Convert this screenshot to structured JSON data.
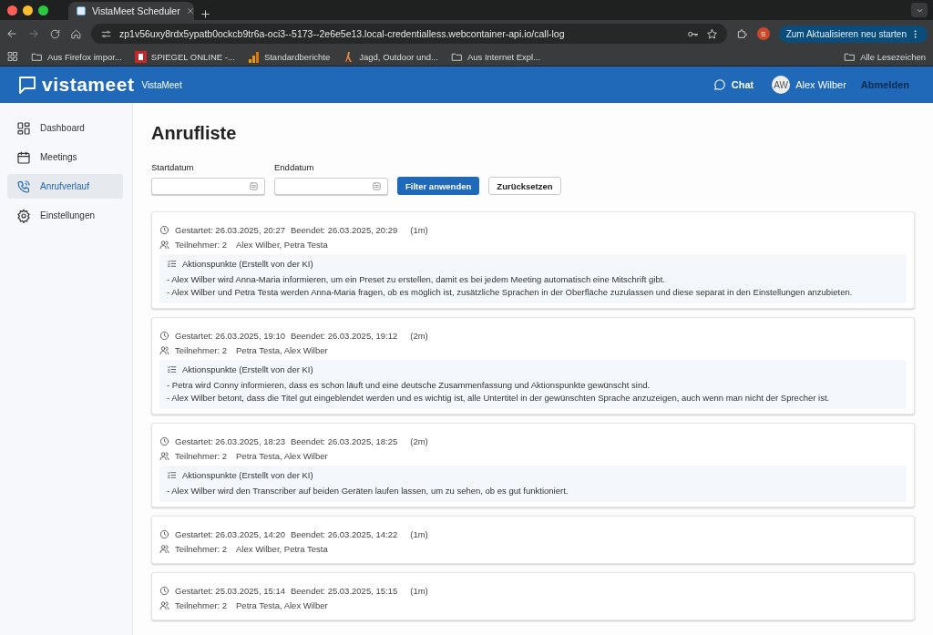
{
  "browser": {
    "tab_title": "VistaMeet Scheduler",
    "url": "zp1v56uxy8rdx5ypatb0ockcb9tr6a-oci3--5173--2e6e5e13.local-credentialless.webcontainer-api.io/call-log",
    "profile_initial": "S",
    "update_button": "Zum Aktualisieren neu starten",
    "bookmarks": [
      {
        "kind": "folder",
        "label": "Aus Firefox impor..."
      },
      {
        "kind": "news",
        "label": "SPIEGEL ONLINE -..."
      },
      {
        "kind": "chart",
        "label": "Standardberichte"
      },
      {
        "kind": "site",
        "label": "Jagd, Outdoor und..."
      },
      {
        "kind": "folder",
        "label": "Aus Internet Expl..."
      }
    ],
    "all_bookmarks": "Alle Lesezeichen"
  },
  "header": {
    "logo": "vistameet",
    "brand": "VistaMeet",
    "chat": "Chat",
    "user_initials": "AW",
    "user_name": "Alex Wilber",
    "logout": "Abmelden"
  },
  "sidebar": {
    "items": [
      {
        "kind": "dashboard",
        "label": "Dashboard",
        "selected": false
      },
      {
        "kind": "calendar",
        "label": "Meetings",
        "selected": false
      },
      {
        "kind": "phone",
        "label": "Anrufverlauf",
        "selected": true
      },
      {
        "kind": "gear",
        "label": "Einstellungen",
        "selected": false
      }
    ]
  },
  "page": {
    "title": "Anrufliste",
    "start_label": "Startdatum",
    "end_label": "Enddatum",
    "apply": "Filter anwenden",
    "reset": "Zurücksetzen"
  },
  "calls": [
    {
      "started": "Gestartet: 26.03.2025, 20:27",
      "ended": "Beendet: 26.03.2025, 20:29",
      "duration": "(1m)",
      "participant_count": "Teilnehmer: 2",
      "participants": "Alex Wilber, Petra Testa",
      "actions_title": "Aktionspunkte (Erstellt von der KI)",
      "actions": [
        "- Alex Wilber wird Anna-Maria informieren, um ein Preset zu erstellen, damit es bei jedem Meeting automatisch eine Mitschrift gibt.",
        "- Alex Wilber und Petra Testa werden Anna-Maria fragen, ob es möglich ist, zusätzliche Sprachen in der Oberfläche zuzulassen und diese separat in den Einstellungen anzubieten."
      ]
    },
    {
      "started": "Gestartet: 26.03.2025, 19:10",
      "ended": "Beendet: 26.03.2025, 19:12",
      "duration": "(2m)",
      "participant_count": "Teilnehmer: 2",
      "participants": "Petra Testa, Alex Wilber",
      "actions_title": "Aktionspunkte (Erstellt von der KI)",
      "actions": [
        "- Petra wird Conny informieren, dass es schon läuft und eine deutsche Zusammenfassung und Aktionspunkte gewünscht sind.",
        "- Alex Wilber betont, dass die Titel gut eingeblendet werden und es wichtig ist, alle Untertitel in der gewünschten Sprache anzuzeigen, auch wenn man nicht der Sprecher ist."
      ]
    },
    {
      "started": "Gestartet: 26.03.2025, 18:23",
      "ended": "Beendet: 26.03.2025, 18:25",
      "duration": "(2m)",
      "participant_count": "Teilnehmer: 2",
      "participants": "Petra Testa, Alex Wilber",
      "actions_title": "Aktionspunkte (Erstellt von der KI)",
      "actions": [
        "- Alex Wilber wird den Transcriber auf beiden Geräten laufen lassen, um zu sehen, ob es gut funktioniert."
      ]
    },
    {
      "started": "Gestartet: 26.03.2025, 14:20",
      "ended": "Beendet: 26.03.2025, 14:22",
      "duration": "(1m)",
      "participant_count": "Teilnehmer: 2",
      "participants": "Alex Wilber, Petra Testa"
    },
    {
      "started": "Gestartet: 25.03.2025, 15:14",
      "ended": "Beendet: 25.03.2025, 15:15",
      "duration": "(1m)",
      "participant_count": "Teilnehmer: 2",
      "participants": "Petra Testa, Alex Wilber"
    }
  ]
}
